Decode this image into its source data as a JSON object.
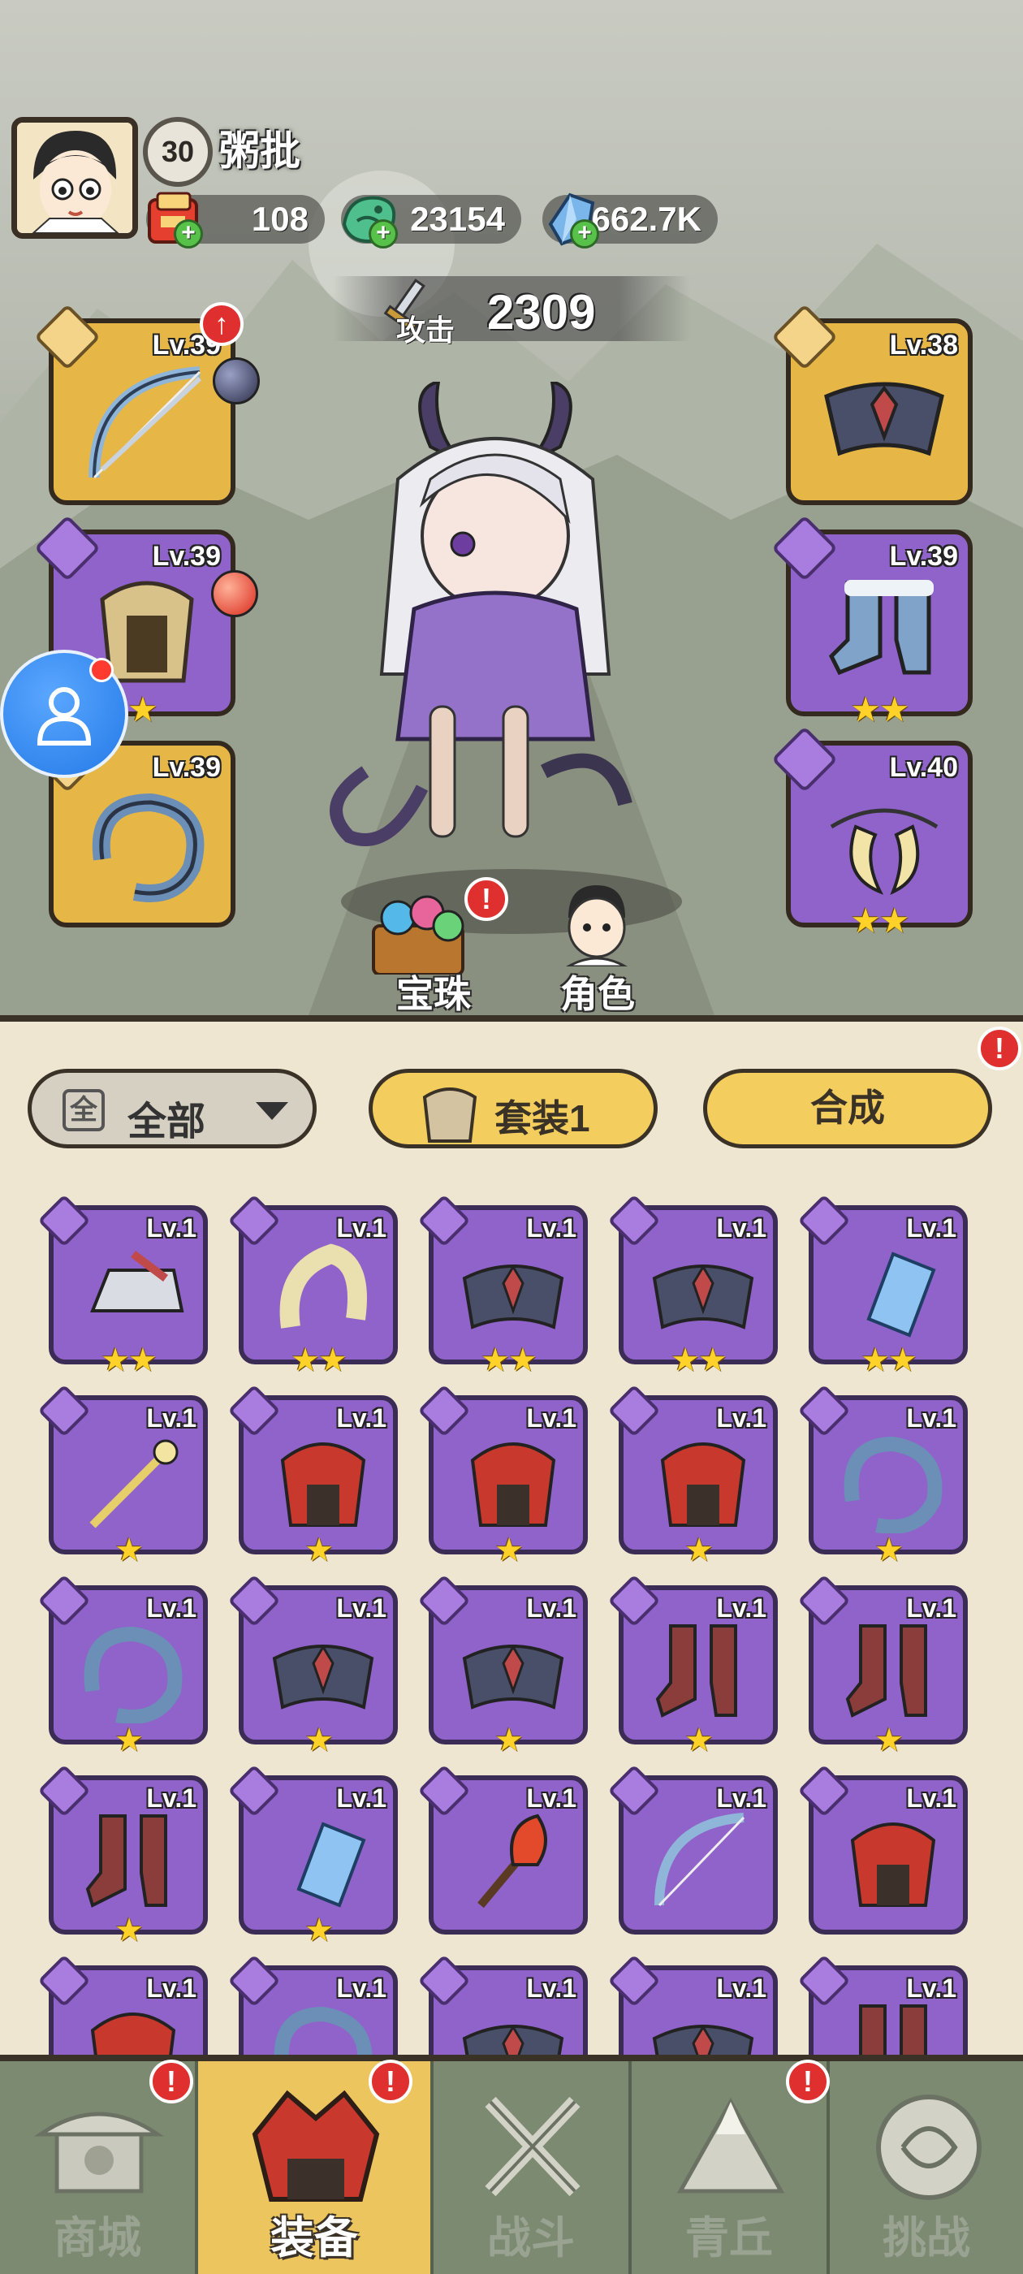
{
  "player": {
    "level": "30",
    "name": "粥批"
  },
  "currencies": [
    {
      "name": "scroll-ticket",
      "value": "108"
    },
    {
      "name": "jade-dragon",
      "value": "23154"
    },
    {
      "name": "crystal",
      "value": "662.7K"
    }
  ],
  "attack": {
    "label": "攻击",
    "value": "2309"
  },
  "equipped": {
    "left": [
      {
        "slot": "weapon",
        "level": "Lv.39",
        "rarity": "gold",
        "stars": 0,
        "upgrade_arrow": true
      },
      {
        "slot": "armor",
        "level": "Lv.39",
        "rarity": "purple",
        "stars": 1
      },
      {
        "slot": "ring",
        "level": "Lv.39",
        "rarity": "gold",
        "stars": 0
      }
    ],
    "right": [
      {
        "slot": "belt",
        "level": "Lv.38",
        "rarity": "gold",
        "stars": 0
      },
      {
        "slot": "boots",
        "level": "Lv.39",
        "rarity": "purple",
        "stars": 2
      },
      {
        "slot": "amulet",
        "level": "Lv.40",
        "rarity": "purple",
        "stars": 2
      }
    ]
  },
  "scene_buttons": {
    "gems": "宝珠",
    "role": "角色"
  },
  "filters": {
    "all_box": "全",
    "all_label": "全部",
    "set_label": "套装1",
    "merge_label": "合成"
  },
  "inventory": [
    {
      "level": "Lv.1",
      "stars": 2,
      "icon": "helmet-icon"
    },
    {
      "level": "Lv.1",
      "stars": 2,
      "icon": "horn-ring-icon"
    },
    {
      "level": "Lv.1",
      "stars": 2,
      "icon": "belt-icon"
    },
    {
      "level": "Lv.1",
      "stars": 2,
      "icon": "belt-icon"
    },
    {
      "level": "Lv.1",
      "stars": 2,
      "icon": "amulet-icon"
    },
    {
      "level": "Lv.1",
      "stars": 1,
      "icon": "staff-icon"
    },
    {
      "level": "Lv.1",
      "stars": 1,
      "icon": "armor-icon"
    },
    {
      "level": "Lv.1",
      "stars": 1,
      "icon": "armor-icon"
    },
    {
      "level": "Lv.1",
      "stars": 1,
      "icon": "armor-icon"
    },
    {
      "level": "Lv.1",
      "stars": 1,
      "icon": "ring-icon"
    },
    {
      "level": "Lv.1",
      "stars": 1,
      "icon": "ring-icon"
    },
    {
      "level": "Lv.1",
      "stars": 1,
      "icon": "belt-icon"
    },
    {
      "level": "Lv.1",
      "stars": 1,
      "icon": "belt-icon"
    },
    {
      "level": "Lv.1",
      "stars": 1,
      "icon": "boots-icon"
    },
    {
      "level": "Lv.1",
      "stars": 1,
      "icon": "boots-icon"
    },
    {
      "level": "Lv.1",
      "stars": 1,
      "icon": "boots-icon"
    },
    {
      "level": "Lv.1",
      "stars": 1,
      "icon": "amulet-icon"
    },
    {
      "level": "Lv.1",
      "stars": 0,
      "icon": "torch-icon"
    },
    {
      "level": "Lv.1",
      "stars": 0,
      "icon": "bow-icon"
    },
    {
      "level": "Lv.1",
      "stars": 0,
      "icon": "armor-icon"
    },
    {
      "level": "Lv.1",
      "stars": 0,
      "icon": "armor-icon"
    },
    {
      "level": "Lv.1",
      "stars": 0,
      "icon": "ring-icon"
    },
    {
      "level": "Lv.1",
      "stars": 0,
      "icon": "belt-icon"
    },
    {
      "level": "Lv.1",
      "stars": 0,
      "icon": "belt-icon"
    },
    {
      "level": "Lv.1",
      "stars": 0,
      "icon": "boots-icon"
    }
  ],
  "tabs": [
    {
      "label": "商城",
      "active": false,
      "alert": true
    },
    {
      "label": "装备",
      "active": true,
      "alert": true
    },
    {
      "label": "战斗",
      "active": false,
      "alert": false
    },
    {
      "label": "青丘",
      "active": false,
      "alert": true
    },
    {
      "label": "挑战",
      "active": false,
      "alert": false
    }
  ],
  "alert_glyph": "!",
  "colors": {
    "gold_slot": "#e6b647",
    "purple_slot": "#8f63c9",
    "active_tab": "#ecc55f",
    "star": "#ffd229"
  }
}
